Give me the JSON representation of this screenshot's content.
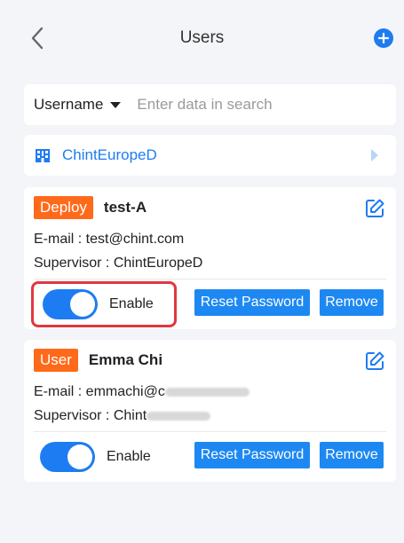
{
  "header": {
    "title": "Users",
    "back_icon": "chevron-left-icon",
    "add_icon": "plus-circle-icon"
  },
  "search": {
    "field_label": "Username",
    "placeholder": "Enter data in search",
    "value": ""
  },
  "organization": {
    "name": "ChintEuropeD",
    "icon": "building-icon"
  },
  "users": [
    {
      "role": "Deploy",
      "name": "test-A",
      "email_label": "E-mail : ",
      "email": "test@chint.com",
      "supervisor_label": "Supervisor : ",
      "supervisor": "ChintEuropeD",
      "toggle_label": "Enable",
      "enabled": true,
      "reset_label": "Reset Password",
      "remove_label": "Remove"
    },
    {
      "role": "User",
      "name": "Emma Chi",
      "email_label": "E-mail : ",
      "email": "emmachi@c",
      "supervisor_label": "Supervisor : ",
      "supervisor": "Chint",
      "toggle_label": "Enable",
      "enabled": true,
      "reset_label": "Reset Password",
      "remove_label": "Remove"
    }
  ],
  "colors": {
    "accent": "#1e7cf2",
    "badge": "#ff6a1a",
    "highlight": "#e0383e",
    "background": "#f4f5f9"
  }
}
